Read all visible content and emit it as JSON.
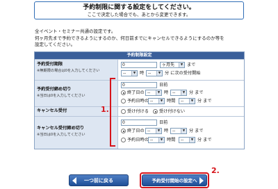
{
  "header": {
    "title": "予約制限に関する設定をしてください。",
    "subtitle": "ここで決定した場合でも、あとから変更できます。"
  },
  "intro": {
    "lines": [
      "全イベント・セミナー共通の設定です。",
      "何ヶ月先まで予約できるようにするのか、何日前までにキャンセルできるようにするのか等を",
      "設定してください。"
    ]
  },
  "table": {
    "header": "予約制限設定",
    "rows": {
      "limit": {
        "label": "予約受付期限",
        "note": "※無期限の場合は0を入力してください",
        "value": "0",
        "unit_select": "ヶ月先",
        "unit_suffix": "まで",
        "time_select1": "--",
        "time_mid": "時",
        "time_select2": "--",
        "time_suffix": "分 に次の受付開始"
      },
      "deadline": {
        "label": "予約受付締め切り",
        "note": "※当日は0を入力してください",
        "value": "0",
        "days_suffix": "日前",
        "opt1_label": "終了日の",
        "opt1_sel1": "--",
        "opt1_hour": "時",
        "opt1_sel2": "--",
        "opt1_suffix": "分 まで",
        "opt2_label": "予約日時の",
        "opt2_sel1": "--",
        "opt2_hour": "時間",
        "opt2_sel2": "--",
        "opt2_suffix": "分 まで"
      },
      "cancel": {
        "label": "キャンセル受付",
        "opt_yes": "受け付ける",
        "opt_no": "受け付けない"
      },
      "cancel_deadline": {
        "label": "キャンセル受付締め切り",
        "note": "※当日は0を入力してください",
        "value": "0",
        "days_suffix": "日前",
        "opt1_label": "終了日の",
        "opt1_sel1": "--",
        "opt1_hour": "時",
        "opt1_sel2": "--",
        "opt1_suffix": "分 まで",
        "opt2_label": "予約日時の",
        "opt2_sel1": "--",
        "opt2_hour": "時間",
        "opt2_sel2": "--",
        "opt2_suffix": "分 まで"
      }
    }
  },
  "annotations": {
    "one": "1.",
    "two": "2."
  },
  "buttons": {
    "back": "一つ前に戻る",
    "next": "予約受付開始の設定へ"
  },
  "colors": {
    "accent": "#2f6db5",
    "header_bg": "#3a5f9a",
    "label_bg": "#dde6f2",
    "highlight": "#d6131a"
  }
}
